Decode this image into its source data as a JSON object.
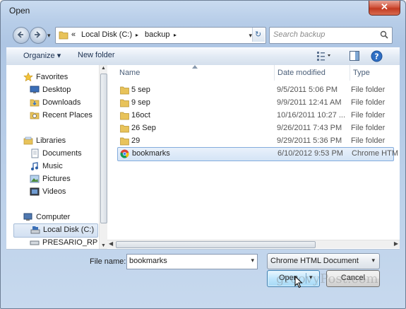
{
  "window": {
    "title": "Open",
    "close_label": "✕"
  },
  "navigation": {
    "address": {
      "overflow": "«",
      "crumbs": [
        "Local Disk (C:)",
        "backup"
      ],
      "separator": "▸"
    },
    "search": {
      "placeholder": "Search backup"
    }
  },
  "toolbar": {
    "organize_label": "Organize ▾",
    "new_folder_label": "New folder"
  },
  "nav_pane": {
    "favorites": {
      "label": "Favorites",
      "items": [
        "Desktop",
        "Downloads",
        "Recent Places"
      ]
    },
    "libraries": {
      "label": "Libraries",
      "items": [
        "Documents",
        "Music",
        "Pictures",
        "Videos"
      ]
    },
    "computer": {
      "label": "Computer",
      "items": [
        "Local Disk (C:)",
        "PRESARIO_RP (D:"
      ]
    }
  },
  "file_list": {
    "columns": [
      "Name",
      "Date modified",
      "Type"
    ],
    "rows": [
      {
        "name": "5 sep",
        "date": "9/5/2011 5:06 PM",
        "type": "File folder",
        "icon": "folder-icon"
      },
      {
        "name": "9 sep",
        "date": "9/9/2011 12:41 AM",
        "type": "File folder",
        "icon": "folder-icon"
      },
      {
        "name": "16oct",
        "date": "10/16/2011 10:27 ...",
        "type": "File folder",
        "icon": "folder-icon"
      },
      {
        "name": "26 Sep",
        "date": "9/26/2011 7:43 PM",
        "type": "File folder",
        "icon": "folder-icon"
      },
      {
        "name": "29",
        "date": "9/29/2011 5:36 PM",
        "type": "File folder",
        "icon": "folder-icon"
      },
      {
        "name": "bookmarks",
        "date": "6/10/2012 9:53 PM",
        "type": "Chrome HTM",
        "icon": "chrome-icon",
        "selected": true
      }
    ]
  },
  "footer": {
    "file_name_label": "File name:",
    "file_name_value": "bookmarks",
    "file_type": "Chrome HTML Document",
    "open_label": "Open",
    "cancel_label": "Cancel",
    "watermark": "groovyPost.com"
  },
  "colors": {
    "accent": "#3c7fb1",
    "selection": "#d4e4f6",
    "folder": "#e8c35a"
  }
}
